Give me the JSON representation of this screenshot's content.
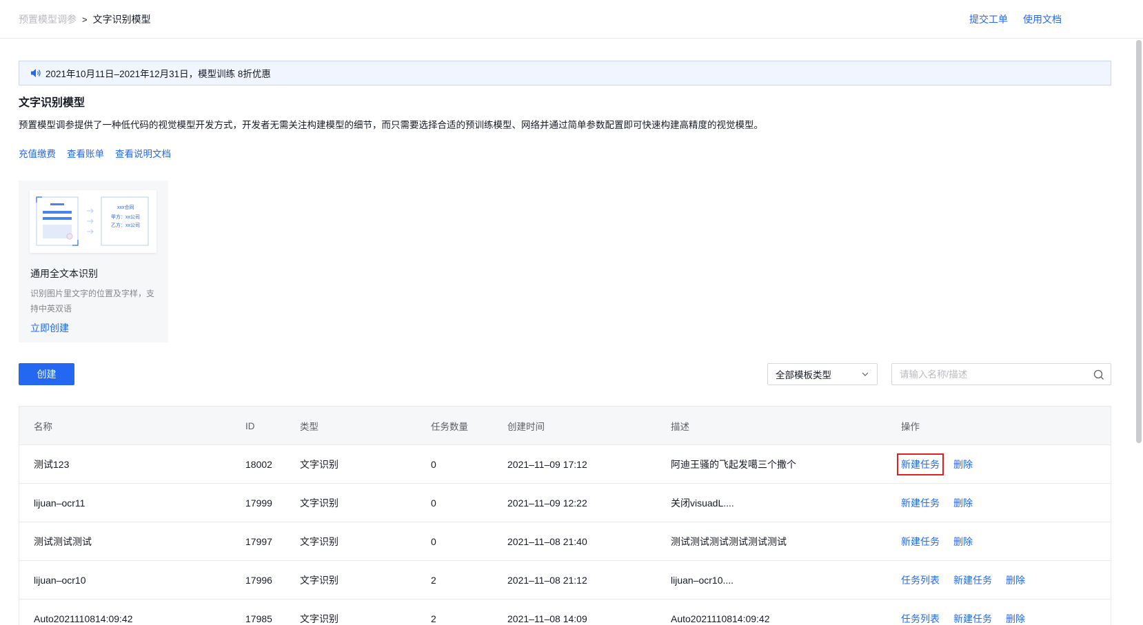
{
  "breadcrumb": {
    "parent": "预置模型调参",
    "separator": ">",
    "current": "文字识别模型"
  },
  "top_links": [
    "提交工单",
    "使用文档"
  ],
  "notice": {
    "text": "2021年10月11日–2021年12月31日，模型训练 8折优惠",
    "icon": "speaker-icon"
  },
  "section": {
    "title": "文字识别模型",
    "description": "预置模型调参提供了一种低代码的视觉模型开发方式，开发者无需关注构建模型的细节，而只需要选择合适的预训练模型、网络并通过简单参数配置即可快速构建高精度的视觉模型。",
    "links": [
      "充值缴费",
      "查看账单",
      "查看说明文档"
    ]
  },
  "template_card": {
    "title": "通用全文本识别",
    "description": "识别图片里文字的位置及字样，支持中英双语",
    "action": "立即创建",
    "thumb_labels": [
      "xxx合同",
      "甲方：xx公司",
      "乙方：xx公司"
    ]
  },
  "toolbar": {
    "create_label": "创建",
    "filter_value": "全部模板类型",
    "search_placeholder": "请输入名称/描述"
  },
  "table": {
    "headers": {
      "name": "名称",
      "id": "ID",
      "type": "类型",
      "tasks": "任务数量",
      "time": "创建时间",
      "desc": "描述",
      "ops": "操作"
    },
    "rows": [
      {
        "name": "测试123",
        "id": "18002",
        "type": "文字识别",
        "tasks": "0",
        "time": "2021–11–09  17:12",
        "desc": "阿迪王骚的飞起发噶三个撒个",
        "ops": [
          "新建任务",
          "删除"
        ]
      },
      {
        "name": "lijuan–ocr11",
        "id": "17999",
        "type": "文字识别",
        "tasks": "0",
        "time": "2021–11–09  12:22",
        "desc": "关闭visuadL....",
        "ops": [
          "新建任务",
          "删除"
        ]
      },
      {
        "name": "测试测试测试",
        "id": "17997",
        "type": "文字识别",
        "tasks": "0",
        "time": "2021–11–08  21:40",
        "desc": "测试测试测试测试测试测试",
        "ops": [
          "新建任务",
          "删除"
        ]
      },
      {
        "name": "lijuan–ocr10",
        "id": "17996",
        "type": "文字识别",
        "tasks": "2",
        "time": "2021–11–08  21:12",
        "desc": "lijuan–ocr10....",
        "ops": [
          "任务列表",
          "新建任务",
          "删除"
        ]
      },
      {
        "name": "Auto2021110814:09:42",
        "id": "17985",
        "type": "文字识别",
        "tasks": "2",
        "time": "2021–11–08  14:09",
        "desc": "Auto2021110814:09:42",
        "ops": [
          "任务列表",
          "新建任务",
          "删除"
        ]
      }
    ]
  },
  "colors": {
    "accent": "#2468f2",
    "highlight": "#e02020"
  }
}
